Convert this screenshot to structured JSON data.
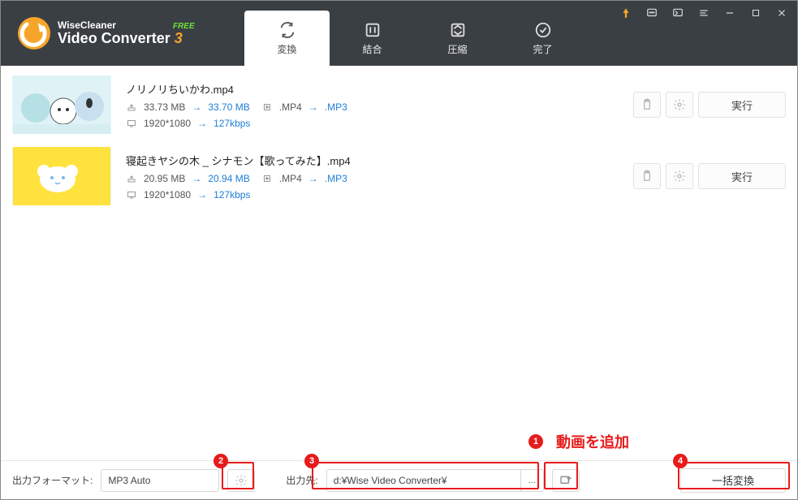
{
  "app": {
    "brand": "WiseCleaner",
    "title": "Video Converter",
    "version_suffix": "3",
    "free_badge": "FREE"
  },
  "tabs": [
    {
      "id": "convert",
      "label": "変換"
    },
    {
      "id": "merge",
      "label": "結合"
    },
    {
      "id": "compress",
      "label": "圧縮"
    },
    {
      "id": "done",
      "label": "完了"
    }
  ],
  "files": [
    {
      "name": "ノリノリちいかわ.mp4",
      "size_in": "33.73 MB",
      "size_out": "33.70 MB",
      "fmt_in": ".MP4",
      "fmt_out": ".MP3",
      "resolution": "1920*1080",
      "bitrate": "127kbps",
      "run_label": "実行"
    },
    {
      "name": "寝起きヤシの木 _ シナモン【歌ってみた】.mp4",
      "size_in": "20.95 MB",
      "size_out": "20.94 MB",
      "fmt_in": ".MP4",
      "fmt_out": ".MP3",
      "resolution": "1920*1080",
      "bitrate": "127kbps",
      "run_label": "実行"
    }
  ],
  "footer": {
    "format_label": "出力フォーマット:",
    "format_value": "MP3 Auto",
    "output_label": "出力先:",
    "output_path": "d:¥Wise Video Converter¥",
    "browse_label": "...",
    "batch_label": "一括変換"
  },
  "annotations": {
    "add_video_text": "動画を追加",
    "numbers": [
      "1",
      "2",
      "3",
      "4"
    ]
  }
}
